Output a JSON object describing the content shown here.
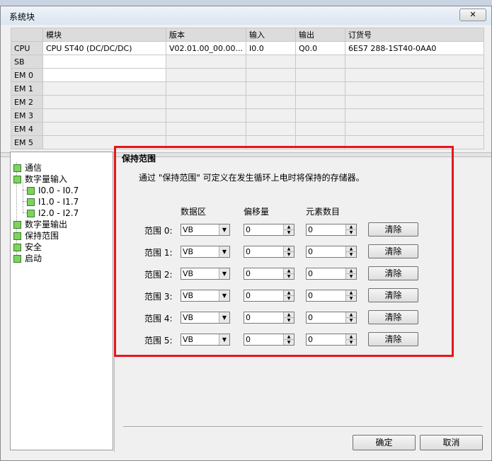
{
  "window": {
    "title": "系统块",
    "close": "✕"
  },
  "grid": {
    "headers": [
      "",
      "模块",
      "版本",
      "输入",
      "输出",
      "订货号"
    ],
    "rows": [
      [
        "CPU",
        "CPU ST40 (DC/DC/DC)",
        "V02.01.00_00.00...",
        "I0.0",
        "Q0.0",
        "6ES7 288-1ST40-0AA0"
      ],
      [
        "SB",
        "",
        "",
        "",
        "",
        ""
      ],
      [
        "EM 0",
        "",
        "",
        "",
        "",
        ""
      ],
      [
        "EM 1",
        "",
        "",
        "",
        "",
        ""
      ],
      [
        "EM 2",
        "",
        "",
        "",
        "",
        ""
      ],
      [
        "EM 3",
        "",
        "",
        "",
        "",
        ""
      ],
      [
        "EM 4",
        "",
        "",
        "",
        "",
        ""
      ],
      [
        "EM 5",
        "",
        "",
        "",
        "",
        ""
      ]
    ]
  },
  "tree": {
    "items": [
      {
        "label": "通信"
      },
      {
        "label": "数字量输入"
      },
      {
        "label": "I0.0 - I0.7"
      },
      {
        "label": "I1.0 - I1.7"
      },
      {
        "label": "I2.0 - I2.7"
      },
      {
        "label": "数字量输出"
      },
      {
        "label": "保持范围"
      },
      {
        "label": "安全"
      },
      {
        "label": "启动"
      }
    ]
  },
  "panel": {
    "title": "保持范围",
    "description": "通过 \"保持范围\" 可定义在发生循环上电时将保持的存储器。",
    "col_area": "数据区",
    "col_offset": "偏移量",
    "col_count": "元素数目",
    "ranges": [
      {
        "label": "范围 0:",
        "area": "VB",
        "offset": "0",
        "count": "0",
        "clear": "清除"
      },
      {
        "label": "范围 1:",
        "area": "VB",
        "offset": "0",
        "count": "0",
        "clear": "清除"
      },
      {
        "label": "范围 2:",
        "area": "VB",
        "offset": "0",
        "count": "0",
        "clear": "清除"
      },
      {
        "label": "范围 3:",
        "area": "VB",
        "offset": "0",
        "count": "0",
        "clear": "清除"
      },
      {
        "label": "范围 4:",
        "area": "VB",
        "offset": "0",
        "count": "0",
        "clear": "清除"
      },
      {
        "label": "范围 5:",
        "area": "VB",
        "offset": "0",
        "count": "0",
        "clear": "清除"
      }
    ]
  },
  "footer": {
    "ok": "确定",
    "cancel": "取消"
  },
  "colors": {
    "highlight_frame": "#e8141e",
    "tree_icon": "#7cd45c"
  }
}
